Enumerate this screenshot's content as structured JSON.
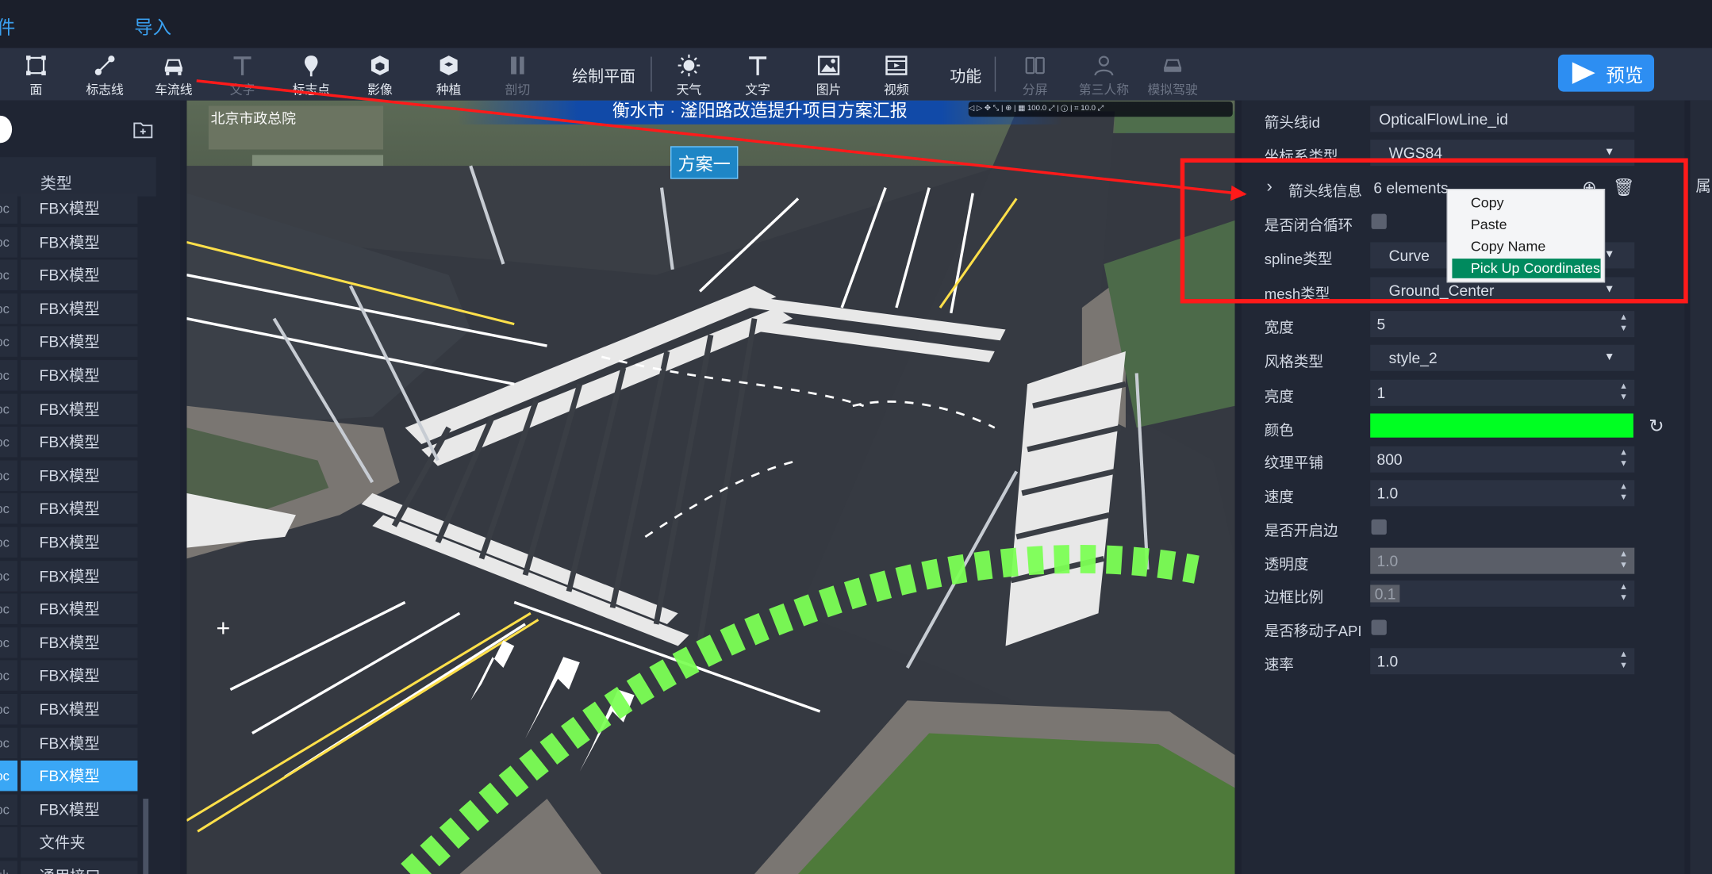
{
  "menu": {
    "file": "件",
    "import": "导入"
  },
  "toolbar": {
    "items": [
      {
        "label": "面",
        "icon": "square-area-icon"
      },
      {
        "label": "标志线",
        "icon": "line-node-icon"
      },
      {
        "label": "车流线",
        "icon": "car-icon"
      },
      {
        "label": "文字",
        "icon": "text-t-icon",
        "disabled": true
      },
      {
        "label": "标志点",
        "icon": "map-pin-icon"
      },
      {
        "label": "影像",
        "icon": "cube-image-icon"
      },
      {
        "label": "种植",
        "icon": "cube-plant-icon"
      },
      {
        "label": "剖切",
        "icon": "section-cut-icon",
        "disabled": true
      }
    ],
    "draw_plane": "绘制平面",
    "items2": [
      {
        "label": "天气",
        "icon": "sun-icon"
      },
      {
        "label": "文字",
        "icon": "text-t-icon"
      },
      {
        "label": "图片",
        "icon": "picture-icon"
      },
      {
        "label": "视频",
        "icon": "film-icon"
      }
    ],
    "function": "功能",
    "items3": [
      {
        "label": "分屏",
        "icon": "split-screen-icon",
        "disabled": true
      },
      {
        "label": "第三人称",
        "icon": "person-icon",
        "disabled": true
      },
      {
        "label": "模拟驾驶",
        "icon": "car-drive-icon",
        "disabled": true
      }
    ],
    "preview": "预览"
  },
  "left_panel": {
    "column_header": "类型",
    "rows": [
      {
        "c0": "oc",
        "type": "FBX模型"
      },
      {
        "c0": "oc",
        "type": "FBX模型"
      },
      {
        "c0": "oc",
        "type": "FBX模型"
      },
      {
        "c0": "oc",
        "type": "FBX模型"
      },
      {
        "c0": "oc",
        "type": "FBX模型"
      },
      {
        "c0": "oc",
        "type": "FBX模型"
      },
      {
        "c0": "oc",
        "type": "FBX模型"
      },
      {
        "c0": "oc",
        "type": "FBX模型"
      },
      {
        "c0": "oc",
        "type": "FBX模型"
      },
      {
        "c0": "oc",
        "type": "FBX模型"
      },
      {
        "c0": "oc",
        "type": "FBX模型"
      },
      {
        "c0": "oc",
        "type": "FBX模型"
      },
      {
        "c0": "oc",
        "type": "FBX模型"
      },
      {
        "c0": "oc",
        "type": "FBX模型"
      },
      {
        "c0": "oc",
        "type": "FBX模型"
      },
      {
        "c0": "oc",
        "type": "FBX模型"
      },
      {
        "c0": "oc",
        "type": "FBX模型"
      },
      {
        "c0": "oc",
        "type": "FBX模型",
        "selected": true
      },
      {
        "c0": "oc",
        "type": "FBX模型"
      },
      {
        "c0": "",
        "type": "文件夹"
      },
      {
        "c0": "汕",
        "type": "通用接口"
      }
    ]
  },
  "viewport": {
    "title": "衡水市 · 滏阳路改造提升项目方案汇报",
    "org": "北京市政总院",
    "scheme": "方案一",
    "mini_toolbar": "◁ ▷ ✥ ⤡ | ⊕ | ▦ 100.0 ⤢ | ⓘ | ⌗ 10.0 ⤢"
  },
  "properties": {
    "rows": [
      {
        "label": "箭头线id",
        "kind": "input",
        "value": "OpticalFlowLine_id"
      },
      {
        "label": "坐标系类型",
        "kind": "select",
        "value": "WGS84"
      },
      {
        "label": "箭头线信息",
        "kind": "array",
        "value": "6 elements"
      },
      {
        "label": "是否闭合循环",
        "kind": "check"
      },
      {
        "label": "spline类型",
        "kind": "select",
        "value": "Curve"
      },
      {
        "label": "mesh类型",
        "kind": "select",
        "value": "Ground_Center"
      },
      {
        "label": "宽度",
        "kind": "spin",
        "value": "5"
      },
      {
        "label": "风格类型",
        "kind": "select",
        "value": "style_2"
      },
      {
        "label": "亮度",
        "kind": "spin",
        "value": "1"
      },
      {
        "label": "颜色",
        "kind": "color",
        "value": "#00ff22"
      },
      {
        "label": "纹理平铺",
        "kind": "spin",
        "value": "800"
      },
      {
        "label": "速度",
        "kind": "spin",
        "value": "1.0"
      },
      {
        "label": "是否开启边",
        "kind": "check"
      },
      {
        "label": "透明度",
        "kind": "spin-grey",
        "value": "1.0"
      },
      {
        "label": "边框比例",
        "kind": "spin-grey2",
        "value": "0.1"
      },
      {
        "label": "是否移动子API",
        "kind": "check"
      },
      {
        "label": "速率",
        "kind": "spin",
        "value": "1.0"
      }
    ],
    "right_tab": "属"
  },
  "context_menu": {
    "items": [
      "Copy",
      "Paste",
      "Copy Name",
      "Pick Up Coordinates"
    ],
    "highlighted": "Pick Up Coordinates",
    "highlight_color": "#008a5e"
  },
  "colors": {
    "accent": "#2d8ef2",
    "selection": "#3aa7f5",
    "annotation": "#ff1a1a"
  }
}
